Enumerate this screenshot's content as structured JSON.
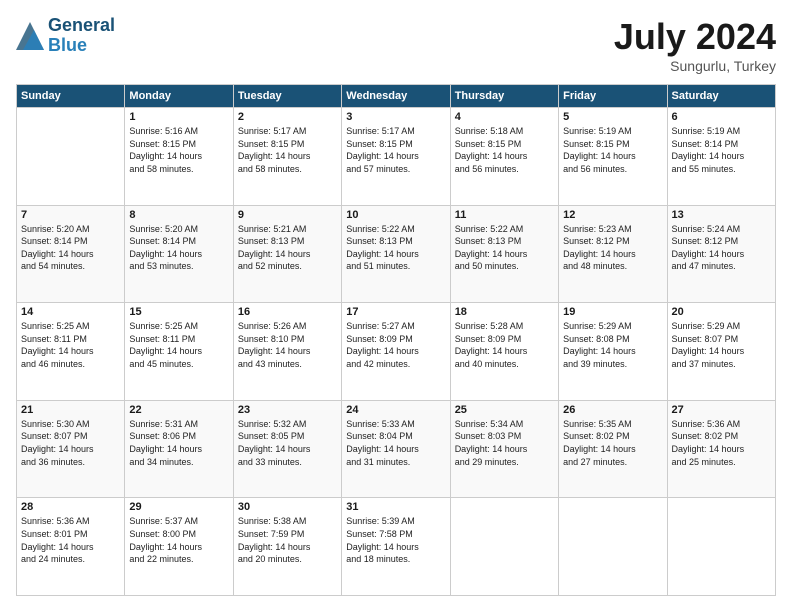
{
  "header": {
    "logo_line1": "General",
    "logo_line2": "Blue",
    "title": "July 2024",
    "subtitle": "Sungurlu, Turkey"
  },
  "calendar": {
    "days_of_week": [
      "Sunday",
      "Monday",
      "Tuesday",
      "Wednesday",
      "Thursday",
      "Friday",
      "Saturday"
    ],
    "weeks": [
      [
        {
          "day": "",
          "info": ""
        },
        {
          "day": "1",
          "info": "Sunrise: 5:16 AM\nSunset: 8:15 PM\nDaylight: 14 hours\nand 58 minutes."
        },
        {
          "day": "2",
          "info": "Sunrise: 5:17 AM\nSunset: 8:15 PM\nDaylight: 14 hours\nand 58 minutes."
        },
        {
          "day": "3",
          "info": "Sunrise: 5:17 AM\nSunset: 8:15 PM\nDaylight: 14 hours\nand 57 minutes."
        },
        {
          "day": "4",
          "info": "Sunrise: 5:18 AM\nSunset: 8:15 PM\nDaylight: 14 hours\nand 56 minutes."
        },
        {
          "day": "5",
          "info": "Sunrise: 5:19 AM\nSunset: 8:15 PM\nDaylight: 14 hours\nand 56 minutes."
        },
        {
          "day": "6",
          "info": "Sunrise: 5:19 AM\nSunset: 8:14 PM\nDaylight: 14 hours\nand 55 minutes."
        }
      ],
      [
        {
          "day": "7",
          "info": "Sunrise: 5:20 AM\nSunset: 8:14 PM\nDaylight: 14 hours\nand 54 minutes."
        },
        {
          "day": "8",
          "info": "Sunrise: 5:20 AM\nSunset: 8:14 PM\nDaylight: 14 hours\nand 53 minutes."
        },
        {
          "day": "9",
          "info": "Sunrise: 5:21 AM\nSunset: 8:13 PM\nDaylight: 14 hours\nand 52 minutes."
        },
        {
          "day": "10",
          "info": "Sunrise: 5:22 AM\nSunset: 8:13 PM\nDaylight: 14 hours\nand 51 minutes."
        },
        {
          "day": "11",
          "info": "Sunrise: 5:22 AM\nSunset: 8:13 PM\nDaylight: 14 hours\nand 50 minutes."
        },
        {
          "day": "12",
          "info": "Sunrise: 5:23 AM\nSunset: 8:12 PM\nDaylight: 14 hours\nand 48 minutes."
        },
        {
          "day": "13",
          "info": "Sunrise: 5:24 AM\nSunset: 8:12 PM\nDaylight: 14 hours\nand 47 minutes."
        }
      ],
      [
        {
          "day": "14",
          "info": "Sunrise: 5:25 AM\nSunset: 8:11 PM\nDaylight: 14 hours\nand 46 minutes."
        },
        {
          "day": "15",
          "info": "Sunrise: 5:25 AM\nSunset: 8:11 PM\nDaylight: 14 hours\nand 45 minutes."
        },
        {
          "day": "16",
          "info": "Sunrise: 5:26 AM\nSunset: 8:10 PM\nDaylight: 14 hours\nand 43 minutes."
        },
        {
          "day": "17",
          "info": "Sunrise: 5:27 AM\nSunset: 8:09 PM\nDaylight: 14 hours\nand 42 minutes."
        },
        {
          "day": "18",
          "info": "Sunrise: 5:28 AM\nSunset: 8:09 PM\nDaylight: 14 hours\nand 40 minutes."
        },
        {
          "day": "19",
          "info": "Sunrise: 5:29 AM\nSunset: 8:08 PM\nDaylight: 14 hours\nand 39 minutes."
        },
        {
          "day": "20",
          "info": "Sunrise: 5:29 AM\nSunset: 8:07 PM\nDaylight: 14 hours\nand 37 minutes."
        }
      ],
      [
        {
          "day": "21",
          "info": "Sunrise: 5:30 AM\nSunset: 8:07 PM\nDaylight: 14 hours\nand 36 minutes."
        },
        {
          "day": "22",
          "info": "Sunrise: 5:31 AM\nSunset: 8:06 PM\nDaylight: 14 hours\nand 34 minutes."
        },
        {
          "day": "23",
          "info": "Sunrise: 5:32 AM\nSunset: 8:05 PM\nDaylight: 14 hours\nand 33 minutes."
        },
        {
          "day": "24",
          "info": "Sunrise: 5:33 AM\nSunset: 8:04 PM\nDaylight: 14 hours\nand 31 minutes."
        },
        {
          "day": "25",
          "info": "Sunrise: 5:34 AM\nSunset: 8:03 PM\nDaylight: 14 hours\nand 29 minutes."
        },
        {
          "day": "26",
          "info": "Sunrise: 5:35 AM\nSunset: 8:02 PM\nDaylight: 14 hours\nand 27 minutes."
        },
        {
          "day": "27",
          "info": "Sunrise: 5:36 AM\nSunset: 8:02 PM\nDaylight: 14 hours\nand 25 minutes."
        }
      ],
      [
        {
          "day": "28",
          "info": "Sunrise: 5:36 AM\nSunset: 8:01 PM\nDaylight: 14 hours\nand 24 minutes."
        },
        {
          "day": "29",
          "info": "Sunrise: 5:37 AM\nSunset: 8:00 PM\nDaylight: 14 hours\nand 22 minutes."
        },
        {
          "day": "30",
          "info": "Sunrise: 5:38 AM\nSunset: 7:59 PM\nDaylight: 14 hours\nand 20 minutes."
        },
        {
          "day": "31",
          "info": "Sunrise: 5:39 AM\nSunset: 7:58 PM\nDaylight: 14 hours\nand 18 minutes."
        },
        {
          "day": "",
          "info": ""
        },
        {
          "day": "",
          "info": ""
        },
        {
          "day": "",
          "info": ""
        }
      ]
    ]
  }
}
